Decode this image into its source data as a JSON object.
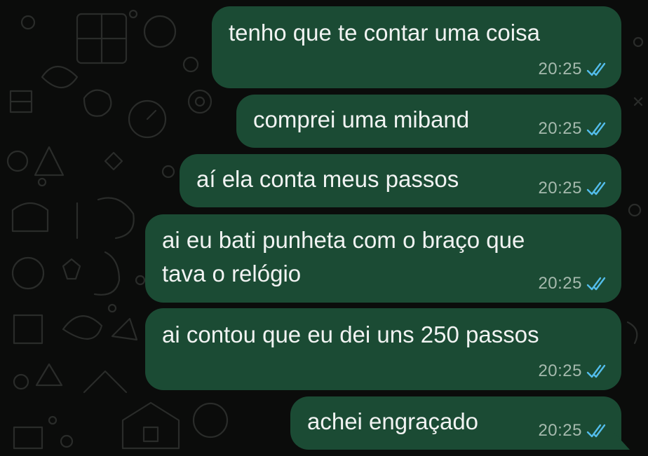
{
  "messages": [
    {
      "text": "tenho que te contar uma coisa",
      "time": "20:25",
      "status": "read"
    },
    {
      "text": "comprei uma miband",
      "time": "20:25",
      "status": "read"
    },
    {
      "text": "aí ela conta meus passos",
      "time": "20:25",
      "status": "read"
    },
    {
      "lines": [
        "ai eu bati punheta com o braço que",
        "tava o relógio"
      ],
      "time": "20:25",
      "status": "read"
    },
    {
      "text": "ai contou que eu dei uns 250 passos",
      "time": "20:25",
      "status": "read"
    },
    {
      "text": "achei engraçado",
      "time": "20:25",
      "status": "read"
    }
  ],
  "colors": {
    "background": "#0b0c0b",
    "bubble_outgoing": "#1b4b34",
    "read_ticks": "#53bdeb",
    "timestamp": "#a5b9ad",
    "text": "#f1f3f2"
  },
  "icons": {
    "read_receipt": "double-check-icon",
    "wallpaper": "doodle-pattern"
  }
}
